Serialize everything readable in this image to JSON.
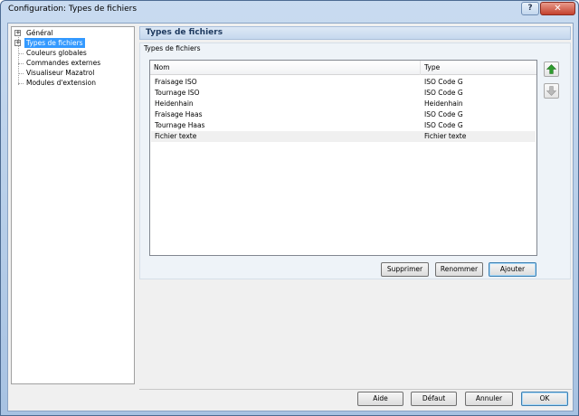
{
  "window": {
    "title": "Configuration: Types de fichiers",
    "help_glyph": "?",
    "close_glyph": "✕"
  },
  "tree": {
    "items": [
      {
        "label": "Général",
        "expandable": true,
        "selected": false
      },
      {
        "label": "Types de fichiers",
        "expandable": true,
        "selected": true
      },
      {
        "label": "Couleurs globales",
        "expandable": false,
        "selected": false
      },
      {
        "label": "Commandes externes",
        "expandable": false,
        "selected": false
      },
      {
        "label": "Visualiseur Mazatrol",
        "expandable": false,
        "selected": false
      },
      {
        "label": "Modules d'extension",
        "expandable": false,
        "selected": false
      }
    ],
    "expander_glyph": "+"
  },
  "panel": {
    "title": "Types de fichiers",
    "group_label": "Types de fichiers",
    "columns": [
      "Nom",
      "Type"
    ],
    "rows": [
      {
        "name": "Fraisage ISO",
        "type": "ISO Code G"
      },
      {
        "name": "Tournage ISO",
        "type": "ISO Code G"
      },
      {
        "name": "Heidenhain",
        "type": "Heidenhain"
      },
      {
        "name": "Fraisage Haas",
        "type": "ISO Code G"
      },
      {
        "name": "Tournage Haas",
        "type": "ISO Code G"
      },
      {
        "name": "Fichier texte",
        "type": "Fichier texte"
      }
    ],
    "selected_row": 5,
    "buttons": {
      "delete": "Supprimer",
      "rename": "Renommer",
      "add": "Ajouter"
    }
  },
  "footer": {
    "help": "Aide",
    "default": "Défaut",
    "cancel": "Annuler",
    "ok": "OK"
  },
  "colors": {
    "selection": "#3399ff",
    "arrow_up": "#2e9c2e",
    "arrow_down_disabled": "#a0a0a0"
  }
}
